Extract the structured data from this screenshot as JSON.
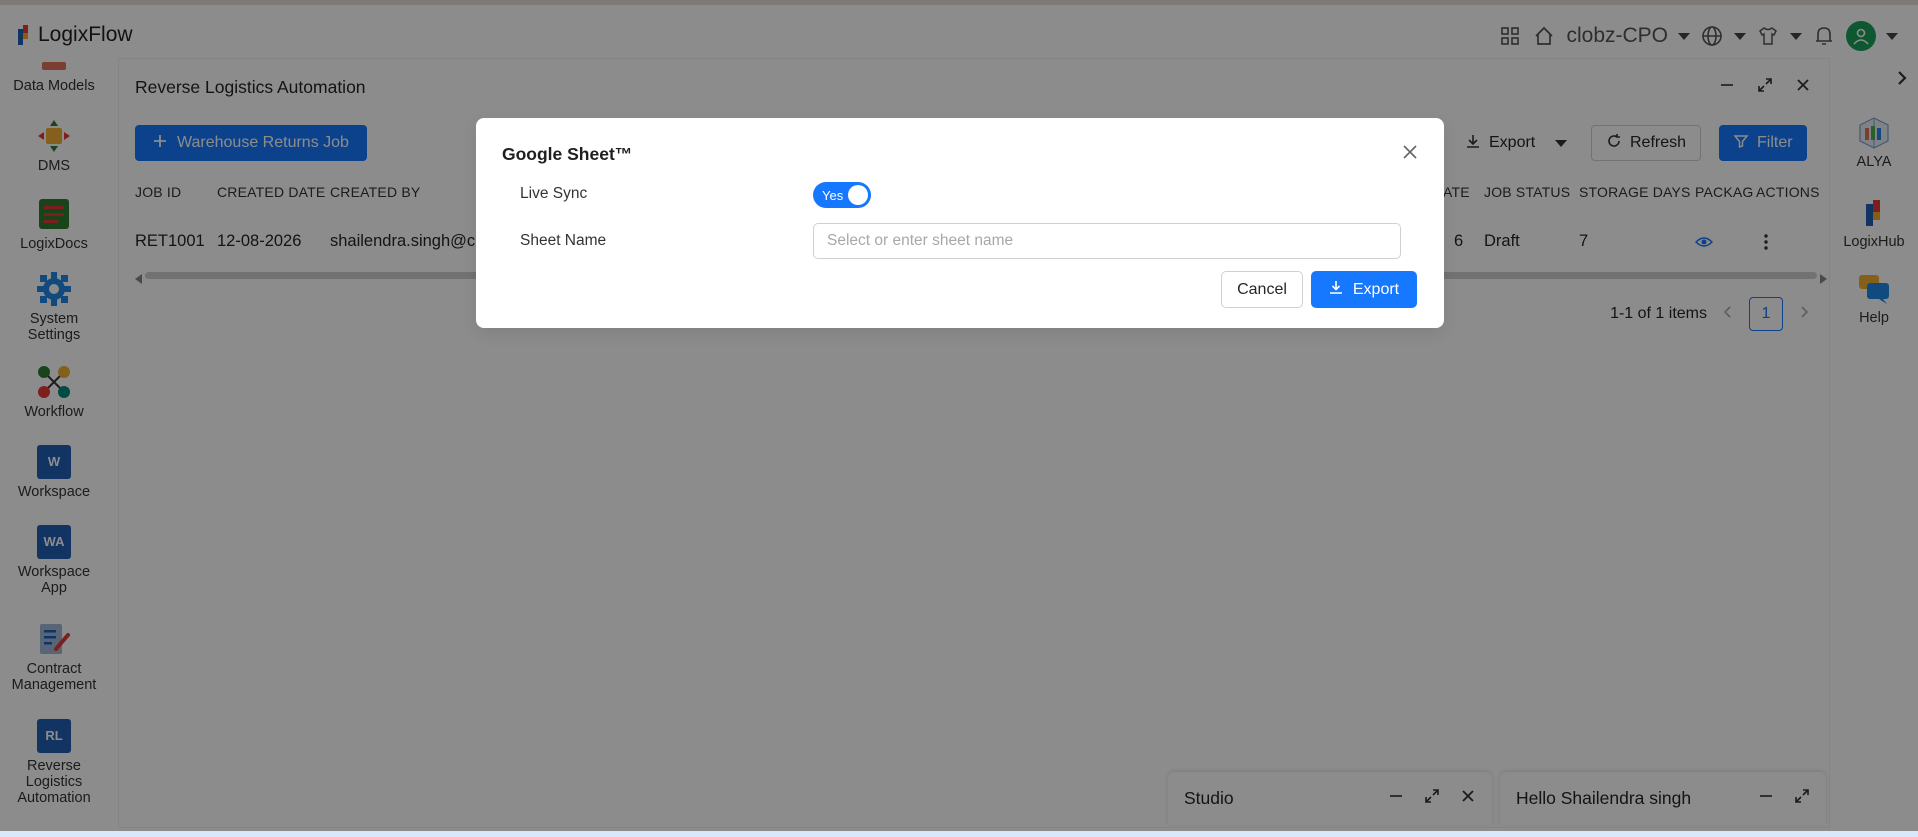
{
  "app": {
    "name": "LogixFlow"
  },
  "topbar": {
    "org_name": "clobz-CPO",
    "icons": [
      "apps-grid-icon",
      "home-icon",
      "globe-icon",
      "shirt-icon",
      "bell-icon",
      "user-avatar-icon"
    ]
  },
  "sidebar": {
    "items": [
      {
        "label": "Data Models",
        "icon": "data-models-icon"
      },
      {
        "label": "DMS",
        "icon": "dms-icon"
      },
      {
        "label": "LogixDocs",
        "icon": "logixdocs-icon"
      },
      {
        "label": "System Settings",
        "icon": "gear-icon"
      },
      {
        "label": "Workflow",
        "icon": "workflow-icon"
      },
      {
        "label": "Workspace",
        "icon": "workspace-icon",
        "tile": "W"
      },
      {
        "label": "Workspace App",
        "icon": "workspace-app-icon",
        "tile": "WA"
      },
      {
        "label": "Contract Management",
        "icon": "contract-icon"
      },
      {
        "label": "Reverse Logistics Automation",
        "icon": "reverse-logistics-icon",
        "tile": "RL"
      }
    ]
  },
  "rightbar": {
    "items": [
      {
        "label": "ALYA",
        "icon": "alya-icon"
      },
      {
        "label": "LogixHub",
        "icon": "logixhub-icon"
      },
      {
        "label": "Help",
        "icon": "help-chat-icon"
      }
    ]
  },
  "window": {
    "title": "Reverse Logistics Automation",
    "add_button": "Warehouse Returns Job",
    "export_button": "Export",
    "refresh_button": "Refresh",
    "filter_button": "Filter",
    "columns": [
      "JOB ID",
      "CREATED DATE",
      "CREATED BY",
      "ATE",
      "JOB STATUS",
      "STORAGE DAYS",
      "PACKAG",
      "ACTIONS"
    ],
    "row": {
      "job_id": "RET1001",
      "created_date": "12-08-2026",
      "created_by": "shailendra.singh@cl",
      "date_partial": "6",
      "job_status": "Draft",
      "storage_days": "7"
    },
    "pagination": {
      "summary": "1-1 of 1 items",
      "current_page": "1"
    }
  },
  "modal": {
    "title": "Google Sheet™",
    "live_sync_label": "Live Sync",
    "live_sync_value": "Yes",
    "sheet_name_label": "Sheet Name",
    "sheet_name_placeholder": "Select or enter sheet name",
    "cancel_label": "Cancel",
    "export_label": "Export"
  },
  "dock": {
    "studio_title": "Studio",
    "chat_title": "Hello Shailendra singh"
  },
  "colors": {
    "primary": "#1677ff",
    "tile": "#1f5fb5",
    "avatar": "#19a05a"
  }
}
